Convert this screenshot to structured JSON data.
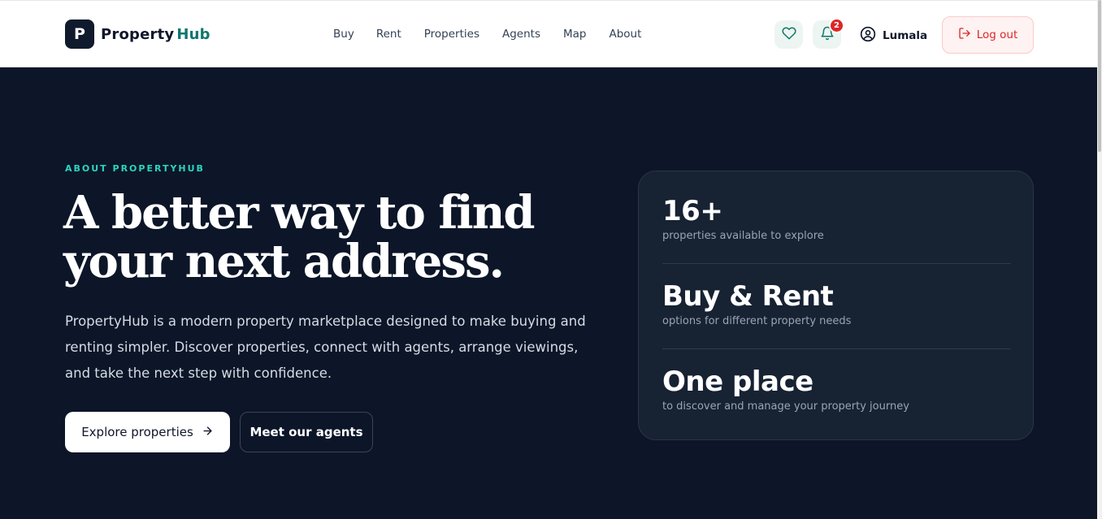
{
  "header": {
    "logo_letter": "P",
    "logo_word1": "Property",
    "logo_word2": "Hub",
    "nav": [
      "Buy",
      "Rent",
      "Properties",
      "Agents",
      "Map",
      "About"
    ],
    "notification_count": "2",
    "user_name": "Lumala",
    "logout_label": "Log out",
    "icons": {
      "favorites": "heart-icon",
      "notifications": "bell-icon",
      "user": "user-circle-icon",
      "logout": "logout-icon"
    }
  },
  "hero": {
    "eyebrow": "ABOUT PROPERTYHUB",
    "headline_line1": "A better way to find",
    "headline_line2": "your next address.",
    "intro_line1": "PropertyHub is a modern property marketplace designed to make buying and",
    "intro_line2": "renting simpler. Discover properties, connect with agents, arrange viewings,",
    "intro_line3": "and take the next step with confidence.",
    "primary_button": "Explore properties",
    "secondary_button": "Meet our agents"
  },
  "stats": [
    {
      "value": "16+",
      "caption": "properties available to explore"
    },
    {
      "value": "Buy & Rent",
      "caption": "options for different property needs"
    },
    {
      "value": "One place",
      "caption": "to discover and manage your property journey"
    }
  ],
  "colors": {
    "hero_bg": "#0c1628",
    "accent_teal": "#2dd4bf",
    "brand_teal": "#0f766e",
    "danger": "#dc2626"
  }
}
